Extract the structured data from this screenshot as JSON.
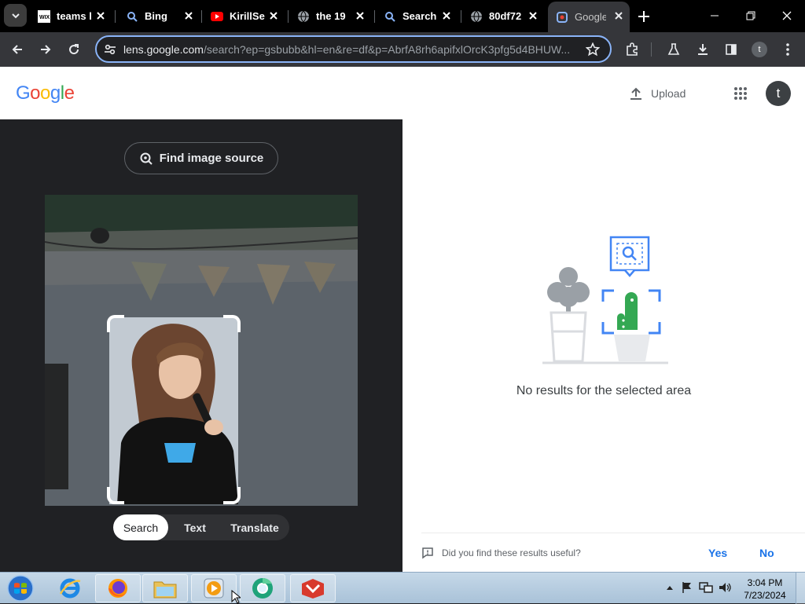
{
  "browser": {
    "tabs": [
      {
        "title": "teams l",
        "favicon": "wix-icon",
        "active": false
      },
      {
        "title": "Bing",
        "favicon": "search-icon",
        "active": false
      },
      {
        "title": "KirillSe",
        "favicon": "youtube-icon",
        "active": false
      },
      {
        "title": "the 19",
        "favicon": "globe-icon",
        "active": false
      },
      {
        "title": "Search",
        "favicon": "search-icon",
        "active": false
      },
      {
        "title": "80df72",
        "favicon": "globe-icon",
        "active": false
      },
      {
        "title": "Google",
        "favicon": "lens-icon",
        "active": true
      }
    ],
    "url_domain": "lens.google.com",
    "url_rest": "/search?ep=gsbubb&hl=en&re=df&p=AbrfA8rh6apifxlOrcK3pfg5d4BHUW...",
    "profile_initial": "t"
  },
  "lens": {
    "logo_text": "Google",
    "upload_label": "Upload",
    "avatar_initial": "t",
    "find_source_label": "Find image source",
    "modes": [
      {
        "label": "Search",
        "selected": true
      },
      {
        "label": "Text",
        "selected": false
      },
      {
        "label": "Translate",
        "selected": false
      }
    ],
    "no_results_text": "No results for the selected area",
    "feedback_question": "Did you find these results useful?",
    "feedback_yes": "Yes",
    "feedback_no": "No"
  },
  "taskbar": {
    "pinned": [
      "internet-explorer-icon",
      "firefox-icon",
      "file-explorer-icon",
      "media-player-icon",
      "chrome-canary-icon",
      "red-app-icon"
    ],
    "clock_time": "3:04 PM",
    "clock_date": "7/23/2024"
  },
  "colors": {
    "accent": "#8ab4f8",
    "link_blue": "#1a73e8",
    "dark_bg": "#202124"
  }
}
